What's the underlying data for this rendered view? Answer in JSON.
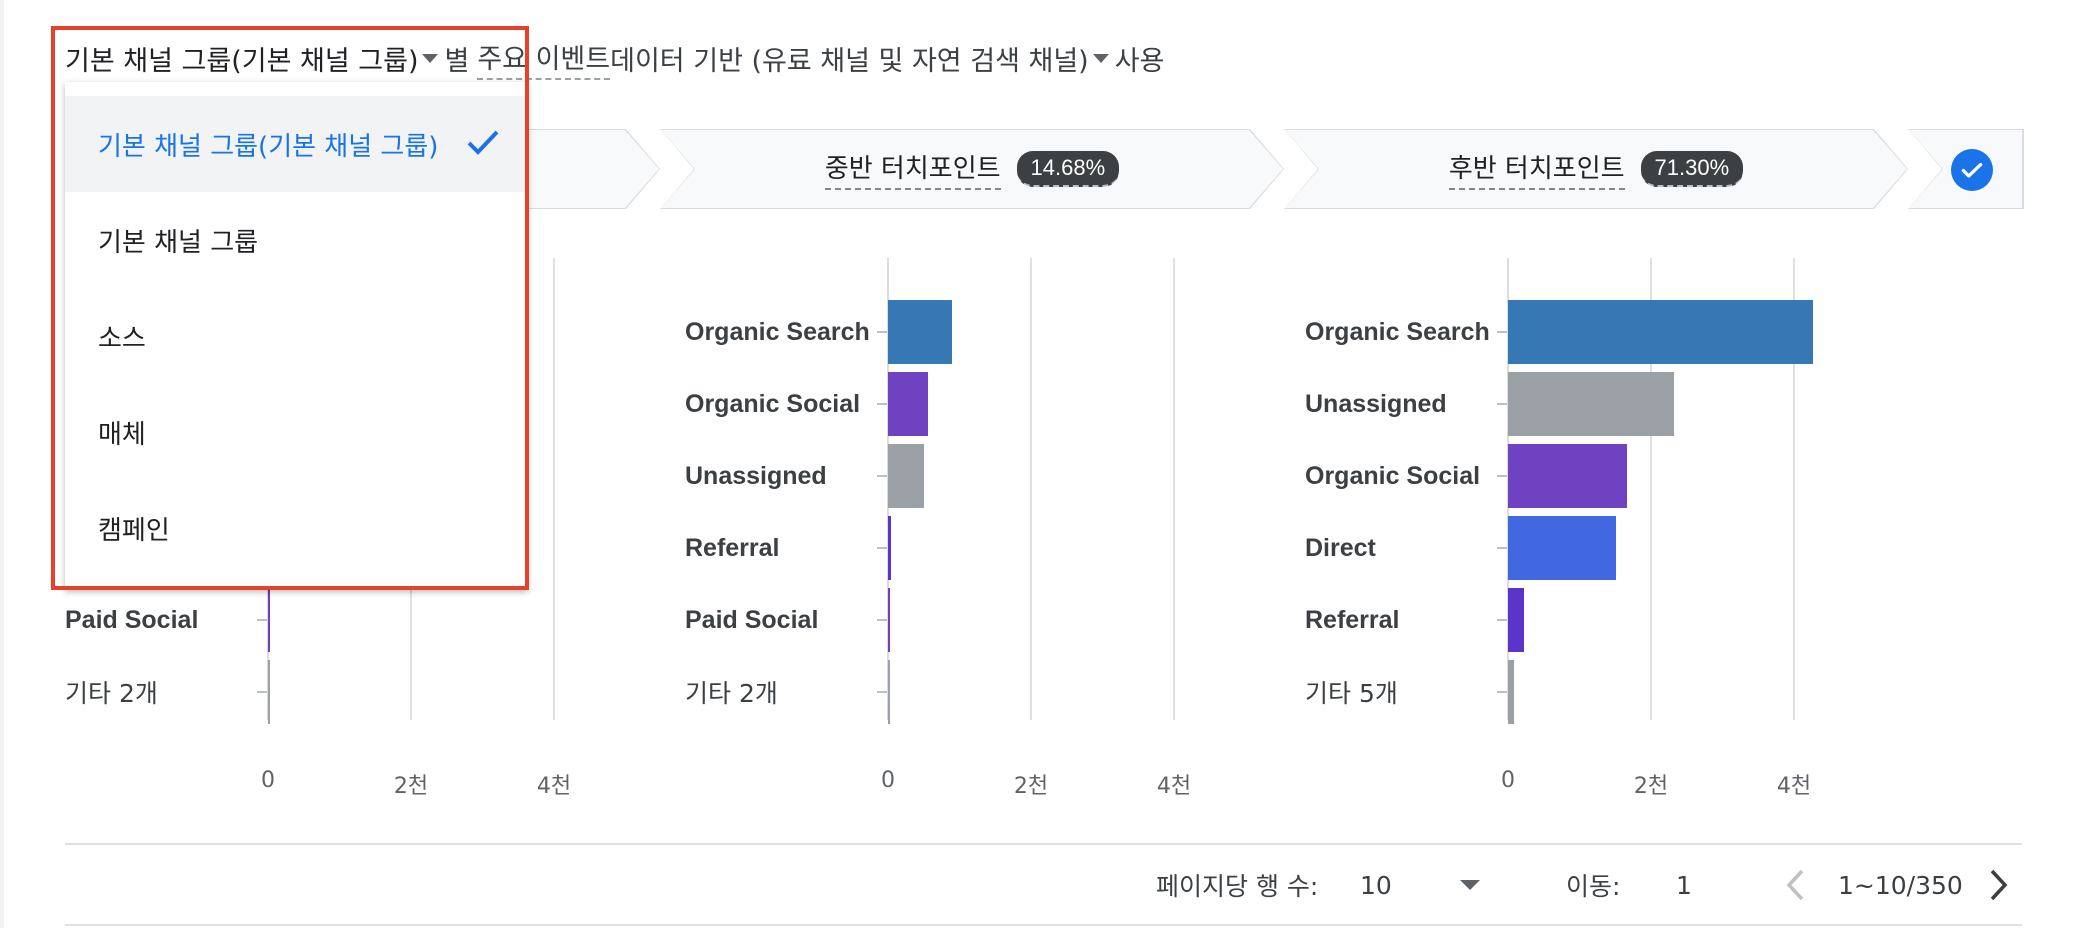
{
  "header": {
    "dimension": "기본 채널 그룹(기본 채널 그룹)",
    "by": "별",
    "metric": "주요 이벤트",
    "suffix": "데이터 기반 (유료 채널 및 자연 검색 채널)",
    "tail": "사용"
  },
  "stages": [
    {
      "title": "",
      "badge": ""
    },
    {
      "title": "중반 터치포인트",
      "badge": "14.68%"
    },
    {
      "title": "후반 터치포인트",
      "badge": "71.30%"
    }
  ],
  "dropdown": {
    "items": [
      {
        "label": "기본 채널 그룹(기본 채널 그룹)",
        "selected": true
      },
      {
        "label": "기본 채널 그룹",
        "selected": false
      },
      {
        "label": "소스",
        "selected": false
      },
      {
        "label": "매체",
        "selected": false
      },
      {
        "label": "캠페인",
        "selected": false
      }
    ]
  },
  "colors": {
    "Organic Search": "#3578b4",
    "Organic Social": "#6f42c1",
    "Unassigned": "#9aa0a6",
    "Referral": "#5b34c9",
    "Paid Social": "#7b3ab8",
    "Direct": "#4168e0",
    "other": "#9aa0a6",
    "accent": "#1a73e8",
    "highlight_border": "#e8412b"
  },
  "chart_data": [
    {
      "type": "bar",
      "orientation": "horizontal",
      "categories": [
        "Paid Social",
        "기타 2개"
      ],
      "values": [
        20,
        10
      ],
      "x_ticks": [
        "0",
        "2천",
        "4천"
      ],
      "xlim": [
        0,
        4000
      ]
    },
    {
      "type": "bar",
      "orientation": "horizontal",
      "categories": [
        "Organic Search",
        "Organic Social",
        "Unassigned",
        "Referral",
        "Paid Social",
        "기타 2개"
      ],
      "values": [
        900,
        560,
        500,
        40,
        20,
        10
      ],
      "x_ticks": [
        "0",
        "2천",
        "4천"
      ],
      "xlim": [
        0,
        4000
      ]
    },
    {
      "type": "bar",
      "orientation": "horizontal",
      "categories": [
        "Organic Search",
        "Unassigned",
        "Organic Social",
        "Direct",
        "Referral",
        "기타 5개"
      ],
      "values": [
        4270,
        2320,
        1660,
        1510,
        230,
        90
      ],
      "x_ticks": [
        "0",
        "2천",
        "4천"
      ],
      "xlim": [
        0,
        4000
      ]
    }
  ],
  "footer": {
    "rows_label": "페이지당 행 수:",
    "rows_value": "10",
    "goto_label": "이동:",
    "goto_value": "1",
    "range": "1~10/350"
  }
}
